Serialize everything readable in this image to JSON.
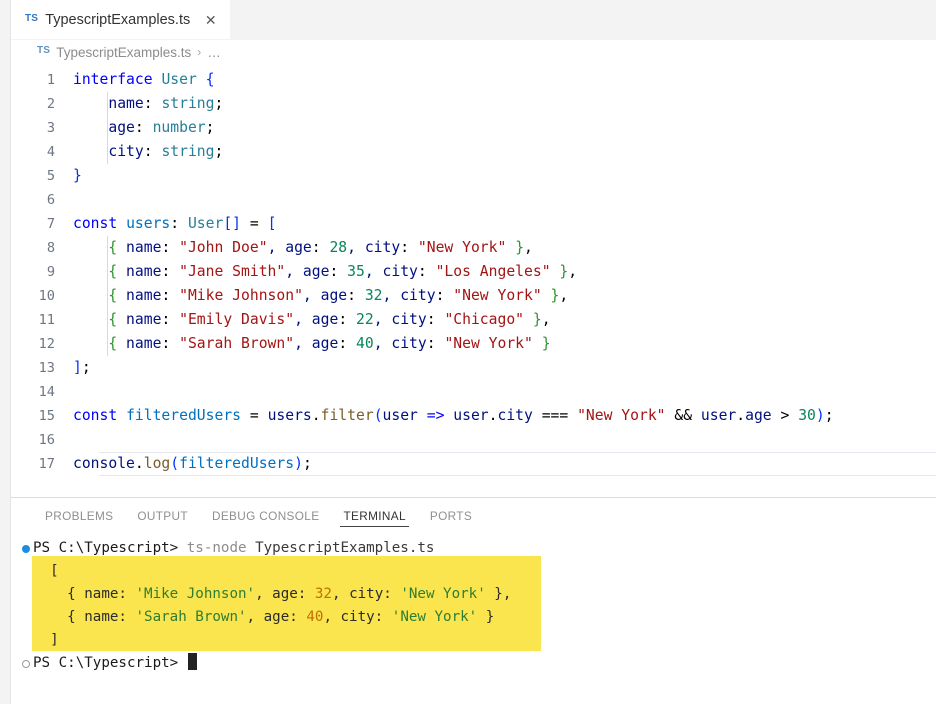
{
  "window": {
    "app": "Visual Studio Code",
    "theme_background": "#ffffff"
  },
  "editor": {
    "tab": {
      "icon": "TS",
      "label": "TypescriptExamples.ts",
      "close_label": "✕",
      "active": true
    },
    "breadcrumb": {
      "icon": "TS",
      "file": "TypescriptExamples.ts",
      "separator": "›",
      "overflow": "…"
    },
    "current_line": 17,
    "lines": [
      {
        "n": 1,
        "tokens": [
          {
            "t": "interface ",
            "c": "t-kw"
          },
          {
            "t": "User",
            "c": "t-type"
          },
          {
            "t": " ",
            "c": "t-plain"
          },
          {
            "t": "{",
            "c": "t-brk1"
          }
        ]
      },
      {
        "n": 2,
        "indent": 1,
        "tokens": [
          {
            "t": "    name",
            "c": "t-varlocal"
          },
          {
            "t": ": ",
            "c": "t-plain"
          },
          {
            "t": "string",
            "c": "t-type"
          },
          {
            "t": ";",
            "c": "t-plain"
          }
        ]
      },
      {
        "n": 3,
        "indent": 1,
        "tokens": [
          {
            "t": "    age",
            "c": "t-varlocal"
          },
          {
            "t": ": ",
            "c": "t-plain"
          },
          {
            "t": "number",
            "c": "t-type"
          },
          {
            "t": ";",
            "c": "t-plain"
          }
        ]
      },
      {
        "n": 4,
        "indent": 1,
        "tokens": [
          {
            "t": "    city",
            "c": "t-varlocal"
          },
          {
            "t": ": ",
            "c": "t-plain"
          },
          {
            "t": "string",
            "c": "t-type"
          },
          {
            "t": ";",
            "c": "t-plain"
          }
        ]
      },
      {
        "n": 5,
        "tokens": [
          {
            "t": "}",
            "c": "t-brk1"
          }
        ]
      },
      {
        "n": 6,
        "tokens": [
          {
            "t": "",
            "c": "t-plain"
          }
        ]
      },
      {
        "n": 7,
        "tokens": [
          {
            "t": "const ",
            "c": "t-kw"
          },
          {
            "t": "users",
            "c": "t-var"
          },
          {
            "t": ": ",
            "c": "t-plain"
          },
          {
            "t": "User",
            "c": "t-type"
          },
          {
            "t": "[]",
            "c": "t-brk1"
          },
          {
            "t": " = ",
            "c": "t-plain"
          },
          {
            "t": "[",
            "c": "t-brk1"
          }
        ]
      },
      {
        "n": 8,
        "indent": 1,
        "tokens": [
          {
            "t": "    ",
            "c": "t-plain"
          },
          {
            "t": "{",
            "c": "t-brk2"
          },
          {
            "t": " name",
            "c": "t-varlocal"
          },
          {
            "t": ": ",
            "c": "t-plain"
          },
          {
            "t": "\"John Doe\"",
            "c": "t-str"
          },
          {
            "t": ", age",
            "c": "t-varlocal"
          },
          {
            "t": ": ",
            "c": "t-plain"
          },
          {
            "t": "28",
            "c": "t-num"
          },
          {
            "t": ", city",
            "c": "t-varlocal"
          },
          {
            "t": ": ",
            "c": "t-plain"
          },
          {
            "t": "\"New York\"",
            "c": "t-str"
          },
          {
            "t": " ",
            "c": "t-plain"
          },
          {
            "t": "}",
            "c": "t-brk2"
          },
          {
            "t": ",",
            "c": "t-plain"
          }
        ]
      },
      {
        "n": 9,
        "indent": 1,
        "tokens": [
          {
            "t": "    ",
            "c": "t-plain"
          },
          {
            "t": "{",
            "c": "t-brk2"
          },
          {
            "t": " name",
            "c": "t-varlocal"
          },
          {
            "t": ": ",
            "c": "t-plain"
          },
          {
            "t": "\"Jane Smith\"",
            "c": "t-str"
          },
          {
            "t": ", age",
            "c": "t-varlocal"
          },
          {
            "t": ": ",
            "c": "t-plain"
          },
          {
            "t": "35",
            "c": "t-num"
          },
          {
            "t": ", city",
            "c": "t-varlocal"
          },
          {
            "t": ": ",
            "c": "t-plain"
          },
          {
            "t": "\"Los Angeles\"",
            "c": "t-str"
          },
          {
            "t": " ",
            "c": "t-plain"
          },
          {
            "t": "}",
            "c": "t-brk2"
          },
          {
            "t": ",",
            "c": "t-plain"
          }
        ]
      },
      {
        "n": 10,
        "indent": 1,
        "tokens": [
          {
            "t": "    ",
            "c": "t-plain"
          },
          {
            "t": "{",
            "c": "t-brk2"
          },
          {
            "t": " name",
            "c": "t-varlocal"
          },
          {
            "t": ": ",
            "c": "t-plain"
          },
          {
            "t": "\"Mike Johnson\"",
            "c": "t-str"
          },
          {
            "t": ", age",
            "c": "t-varlocal"
          },
          {
            "t": ": ",
            "c": "t-plain"
          },
          {
            "t": "32",
            "c": "t-num"
          },
          {
            "t": ", city",
            "c": "t-varlocal"
          },
          {
            "t": ": ",
            "c": "t-plain"
          },
          {
            "t": "\"New York\"",
            "c": "t-str"
          },
          {
            "t": " ",
            "c": "t-plain"
          },
          {
            "t": "}",
            "c": "t-brk2"
          },
          {
            "t": ",",
            "c": "t-plain"
          }
        ]
      },
      {
        "n": 11,
        "indent": 1,
        "tokens": [
          {
            "t": "    ",
            "c": "t-plain"
          },
          {
            "t": "{",
            "c": "t-brk2"
          },
          {
            "t": " name",
            "c": "t-varlocal"
          },
          {
            "t": ": ",
            "c": "t-plain"
          },
          {
            "t": "\"Emily Davis\"",
            "c": "t-str"
          },
          {
            "t": ", age",
            "c": "t-varlocal"
          },
          {
            "t": ": ",
            "c": "t-plain"
          },
          {
            "t": "22",
            "c": "t-num"
          },
          {
            "t": ", city",
            "c": "t-varlocal"
          },
          {
            "t": ": ",
            "c": "t-plain"
          },
          {
            "t": "\"Chicago\"",
            "c": "t-str"
          },
          {
            "t": " ",
            "c": "t-plain"
          },
          {
            "t": "}",
            "c": "t-brk2"
          },
          {
            "t": ",",
            "c": "t-plain"
          }
        ]
      },
      {
        "n": 12,
        "indent": 1,
        "tokens": [
          {
            "t": "    ",
            "c": "t-plain"
          },
          {
            "t": "{",
            "c": "t-brk2"
          },
          {
            "t": " name",
            "c": "t-varlocal"
          },
          {
            "t": ": ",
            "c": "t-plain"
          },
          {
            "t": "\"Sarah Brown\"",
            "c": "t-str"
          },
          {
            "t": ", age",
            "c": "t-varlocal"
          },
          {
            "t": ": ",
            "c": "t-plain"
          },
          {
            "t": "40",
            "c": "t-num"
          },
          {
            "t": ", city",
            "c": "t-varlocal"
          },
          {
            "t": ": ",
            "c": "t-plain"
          },
          {
            "t": "\"New York\"",
            "c": "t-str"
          },
          {
            "t": " ",
            "c": "t-plain"
          },
          {
            "t": "}",
            "c": "t-brk2"
          }
        ]
      },
      {
        "n": 13,
        "tokens": [
          {
            "t": "]",
            "c": "t-brk1"
          },
          {
            "t": ";",
            "c": "t-plain"
          }
        ]
      },
      {
        "n": 14,
        "tokens": [
          {
            "t": "",
            "c": "t-plain"
          }
        ]
      },
      {
        "n": 15,
        "tokens": [
          {
            "t": "const ",
            "c": "t-kw"
          },
          {
            "t": "filteredUsers",
            "c": "t-var"
          },
          {
            "t": " = ",
            "c": "t-plain"
          },
          {
            "t": "users",
            "c": "t-varlocal"
          },
          {
            "t": ".",
            "c": "t-plain"
          },
          {
            "t": "filter",
            "c": "t-fn"
          },
          {
            "t": "(",
            "c": "t-brk1"
          },
          {
            "t": "user",
            "c": "t-varlocal"
          },
          {
            "t": " ",
            "c": "t-plain"
          },
          {
            "t": "=>",
            "c": "t-kw"
          },
          {
            "t": " user",
            "c": "t-varlocal"
          },
          {
            "t": ".",
            "c": "t-plain"
          },
          {
            "t": "city",
            "c": "t-varlocal"
          },
          {
            "t": " === ",
            "c": "t-plain"
          },
          {
            "t": "\"New York\"",
            "c": "t-str"
          },
          {
            "t": " && ",
            "c": "t-plain"
          },
          {
            "t": "user",
            "c": "t-varlocal"
          },
          {
            "t": ".",
            "c": "t-plain"
          },
          {
            "t": "age",
            "c": "t-varlocal"
          },
          {
            "t": " > ",
            "c": "t-plain"
          },
          {
            "t": "30",
            "c": "t-num"
          },
          {
            "t": ")",
            "c": "t-brk1"
          },
          {
            "t": ";",
            "c": "t-plain"
          }
        ]
      },
      {
        "n": 16,
        "tokens": [
          {
            "t": "",
            "c": "t-plain"
          }
        ]
      },
      {
        "n": 17,
        "current": true,
        "tokens": [
          {
            "t": "console",
            "c": "t-varlocal"
          },
          {
            "t": ".",
            "c": "t-plain"
          },
          {
            "t": "log",
            "c": "t-fn"
          },
          {
            "t": "(",
            "c": "t-brk1"
          },
          {
            "t": "filteredUsers",
            "c": "t-var"
          },
          {
            "t": ")",
            "c": "t-brk1"
          },
          {
            "t": ";",
            "c": "t-plain"
          }
        ]
      }
    ]
  },
  "panel": {
    "tabs": [
      {
        "label": "PROBLEMS",
        "active": false
      },
      {
        "label": "OUTPUT",
        "active": false
      },
      {
        "label": "DEBUG CONSOLE",
        "active": false
      },
      {
        "label": "TERMINAL",
        "active": true
      },
      {
        "label": "PORTS",
        "active": false
      }
    ],
    "terminal": {
      "highlight_color": "#fbe54e",
      "lines": [
        {
          "deco": "dot-filled",
          "segments": [
            {
              "t": "PS C:\\Typescript> ",
              "c": "pm-prompt"
            },
            {
              "t": "ts-node ",
              "c": "pm-cmd"
            },
            {
              "t": "TypescriptExamples.ts",
              "c": "pm-arg"
            }
          ]
        },
        {
          "deco": "none",
          "highlighted": true,
          "segments": [
            {
              "t": "  [",
              "c": "o-punct"
            }
          ]
        },
        {
          "deco": "none",
          "highlighted": true,
          "segments": [
            {
              "t": "    { name: ",
              "c": "o-key"
            },
            {
              "t": "'Mike Johnson'",
              "c": "o-str"
            },
            {
              "t": ", age: ",
              "c": "o-key"
            },
            {
              "t": "32",
              "c": "o-num"
            },
            {
              "t": ", city: ",
              "c": "o-key"
            },
            {
              "t": "'New York'",
              "c": "o-str"
            },
            {
              "t": " },",
              "c": "o-punct"
            }
          ]
        },
        {
          "deco": "none",
          "highlighted": true,
          "segments": [
            {
              "t": "    { name: ",
              "c": "o-key"
            },
            {
              "t": "'Sarah Brown'",
              "c": "o-str"
            },
            {
              "t": ", age: ",
              "c": "o-key"
            },
            {
              "t": "40",
              "c": "o-num"
            },
            {
              "t": ", city: ",
              "c": "o-key"
            },
            {
              "t": "'New York'",
              "c": "o-str"
            },
            {
              "t": " }",
              "c": "o-punct"
            }
          ]
        },
        {
          "deco": "none",
          "highlighted": true,
          "segments": [
            {
              "t": "  ]",
              "c": "o-punct"
            }
          ]
        },
        {
          "deco": "ring",
          "cursor": true,
          "segments": [
            {
              "t": "PS C:\\Typescript> ",
              "c": "pm-prompt"
            }
          ]
        }
      ]
    }
  }
}
